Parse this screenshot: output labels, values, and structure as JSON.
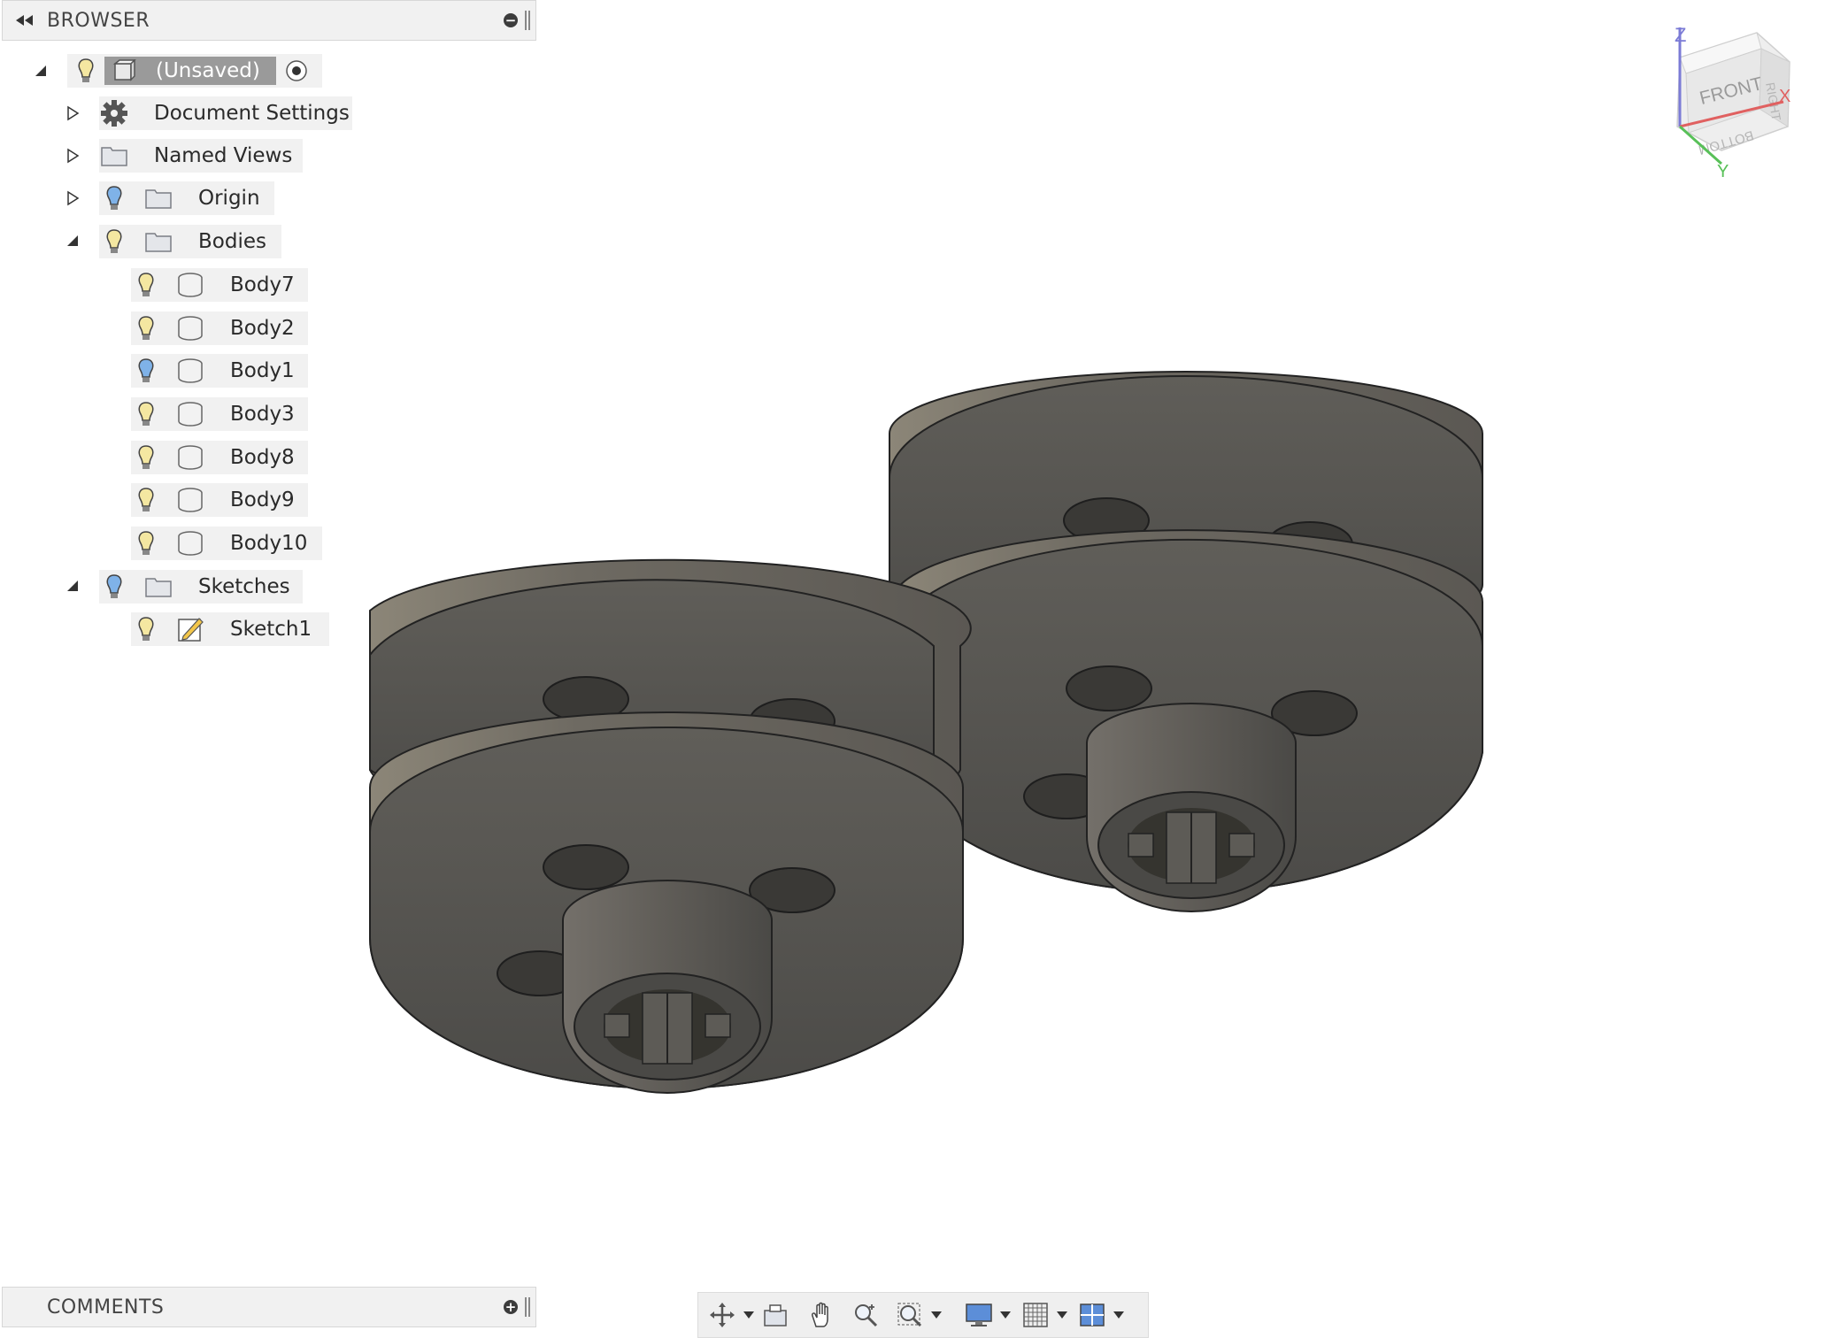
{
  "browser": {
    "title": "BROWSER",
    "root": {
      "label": "(Unsaved)"
    },
    "items": [
      {
        "label": "Document Settings"
      },
      {
        "label": "Named Views"
      },
      {
        "label": "Origin"
      },
      {
        "label": "Bodies"
      }
    ],
    "bodies": [
      "Body7",
      "Body2",
      "Body1",
      "Body3",
      "Body8",
      "Body9",
      "Body10"
    ],
    "sketches": {
      "label": "Sketches",
      "items": [
        "Sketch1"
      ]
    }
  },
  "viewcube": {
    "front": "FRONT",
    "right": "RIGHT",
    "bottom": "BOTTOM",
    "axis_z": "Z",
    "axis_x": "X",
    "axis_y": "Y"
  },
  "comments": {
    "title": "COMMENTS"
  },
  "colors": {
    "panel_bg": "#f1f1f1",
    "root_highlight": "#9a9a9a",
    "bulb_on": "#f4e7a1",
    "bulb_blue": "#7fb2e8",
    "part_body": "#5a5955"
  },
  "toolbar": {
    "tools": [
      "orbit-icon",
      "look-at-icon",
      "pan-icon",
      "zoom-icon",
      "fit-icon",
      "display-settings-icon",
      "grid-icon",
      "viewports-icon"
    ]
  }
}
